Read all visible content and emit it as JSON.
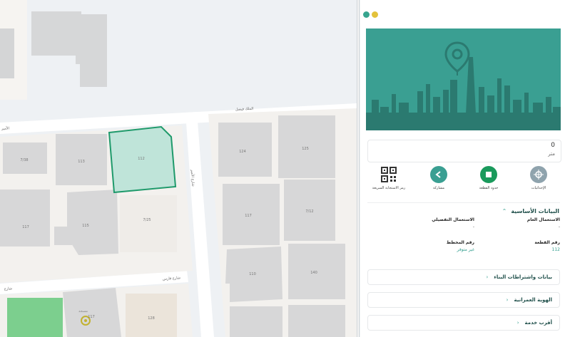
{
  "colors": {
    "brand": "#3a9f92",
    "brand_dark": "#2b7a70",
    "parcel_selected_fill": "#bfe4d9",
    "parcel_selected_stroke": "#1f9a6b",
    "green_area": "#7ccf8e",
    "window_dot_teal": "#37a58f",
    "window_dot_yellow": "#e3c23b",
    "action_gray": "#8fa3ad",
    "action_teal": "#3a9f92",
    "action_green": "#1a9a5c"
  },
  "map": {
    "roads": {
      "top_road": "الملك فيصل",
      "top_road_left": "الأمير",
      "vertical_road": "شارع الأمير",
      "bottom_road": "شارع فارس",
      "bottom_road_left": "شارع"
    },
    "parcels": {
      "selected": "112",
      "p1": "7/38",
      "p2": "113",
      "p3": "117",
      "p4": "115",
      "p5": "7/25",
      "p6": "124",
      "p7": "125",
      "p8": "117",
      "p9": "7/12",
      "p10": "110",
      "p11": "140",
      "p12": "117",
      "p13": "128",
      "p14": "125"
    },
    "poi_label": "مسجد"
  },
  "panel": {
    "parcel_card": {
      "number": "0",
      "unit": "متر"
    },
    "actions": [
      {
        "label": "الإحداثيات",
        "icon": "crosshair-icon"
      },
      {
        "label": "حدود القطعة",
        "icon": "square-icon"
      },
      {
        "label": "مشاركة",
        "icon": "share-icon"
      },
      {
        "label": "رمز الاستجابة السريعة",
        "icon": "qr-code-icon"
      }
    ],
    "basic_info": {
      "title": "البيانات الأساسية",
      "fields": [
        {
          "label": "الاستعمال العام",
          "value": "-"
        },
        {
          "label": "الاستعمال التفصيلي",
          "value": "-"
        },
        {
          "label": "رقم القطعة",
          "value": "112"
        },
        {
          "label": "رقم المخطط",
          "value": "غير متوفر"
        }
      ]
    },
    "sections": [
      {
        "title": "بيانات واشتراطات البناء"
      },
      {
        "title": "الهوية العمرانية"
      },
      {
        "title": "أقرب خدمة"
      }
    ]
  }
}
